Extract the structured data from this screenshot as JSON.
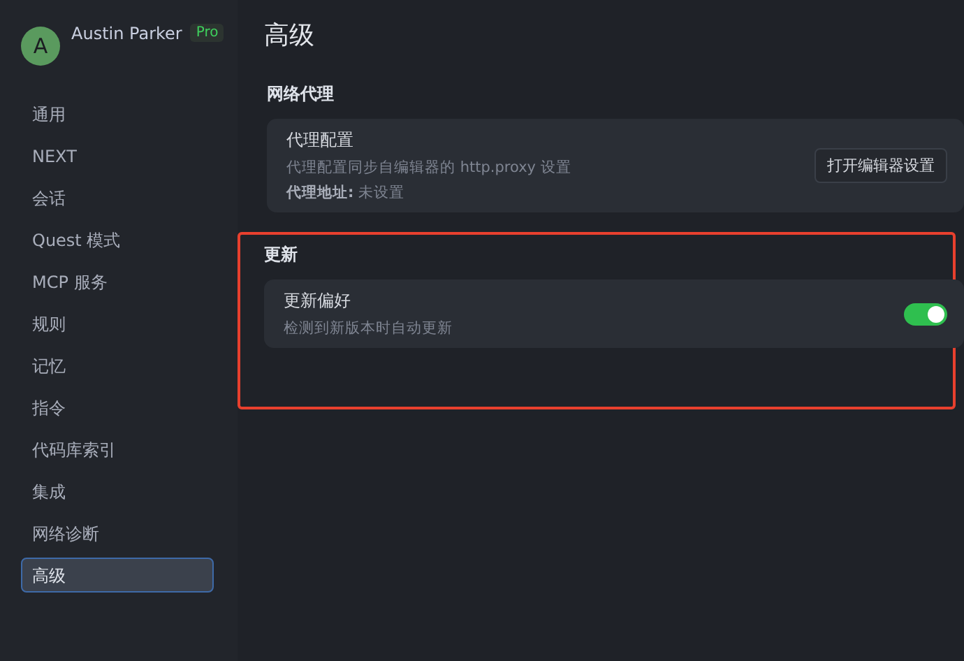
{
  "user": {
    "avatar_letter": "A",
    "name": "Austin Parker",
    "badge": "Pro"
  },
  "sidebar": {
    "items": [
      {
        "label": "通用",
        "selected": false
      },
      {
        "label": "NEXT",
        "selected": false
      },
      {
        "label": "会话",
        "selected": false
      },
      {
        "label": "Quest 模式",
        "selected": false
      },
      {
        "label": "MCP 服务",
        "selected": false
      },
      {
        "label": "规则",
        "selected": false
      },
      {
        "label": "记忆",
        "selected": false
      },
      {
        "label": "指令",
        "selected": false
      },
      {
        "label": "代码库索引",
        "selected": false
      },
      {
        "label": "集成",
        "selected": false
      },
      {
        "label": "网络诊断",
        "selected": false
      },
      {
        "label": "高级",
        "selected": true
      }
    ]
  },
  "page_title": "高级",
  "sections": [
    {
      "title": "网络代理",
      "highlighted": false,
      "cards": [
        {
          "kind": "button",
          "title": "代理配置",
          "description": "代理配置同步自编辑器的 http.proxy 设置",
          "detail_label": "代理地址:",
          "detail_value": "未设置",
          "button": "打开编辑器设置"
        }
      ]
    },
    {
      "title": "更新",
      "highlighted": true,
      "cards": [
        {
          "kind": "toggle",
          "title": "更新偏好",
          "description": "检测到新版本时自动更新",
          "on": true
        }
      ]
    }
  ]
}
